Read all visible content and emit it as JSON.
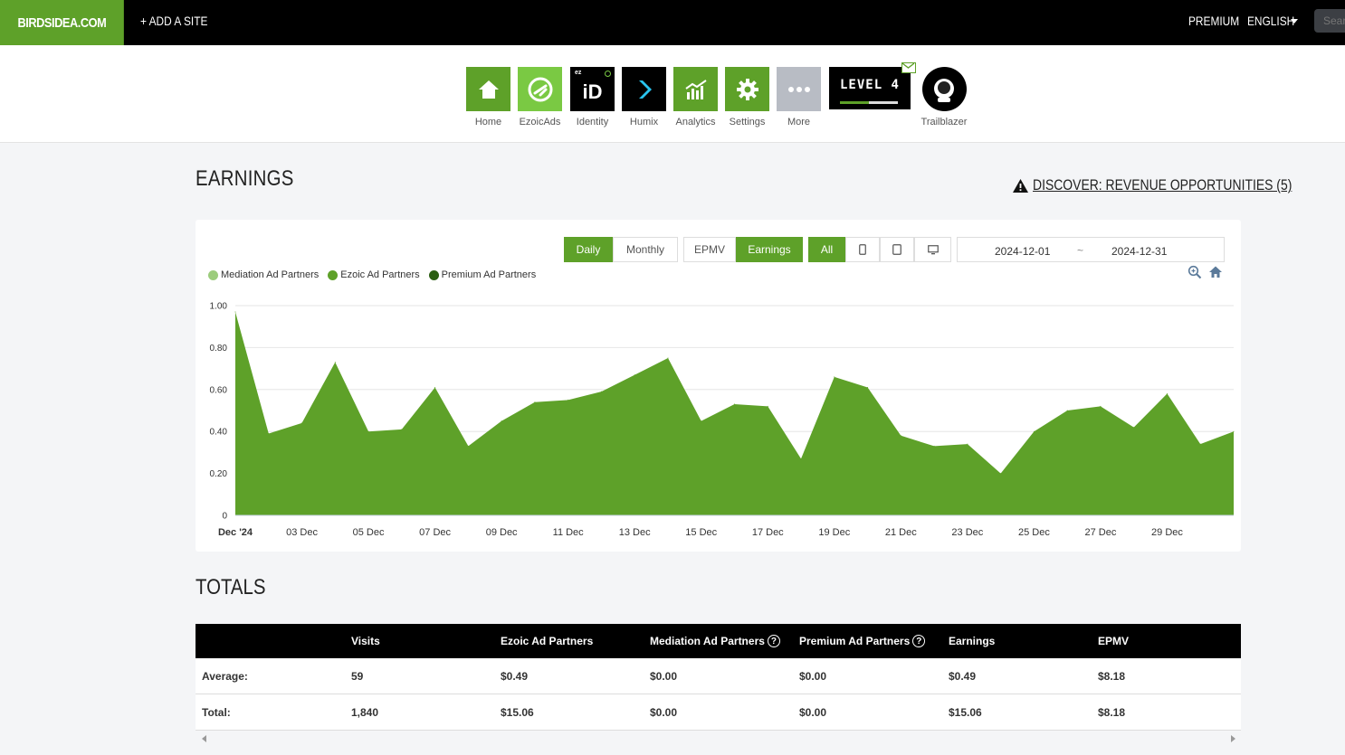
{
  "topbar": {
    "brand": "BIRDSIDEA.COM",
    "add_site": "+ ADD A SITE",
    "premium": "PREMIUM",
    "language": "ENGLISH",
    "search_placeholder": "Search"
  },
  "apps": [
    {
      "label": "Home",
      "icon": "home-icon"
    },
    {
      "label": "EzoicAds",
      "icon": "ezoicads-icon"
    },
    {
      "label": "Identity",
      "icon": "identity-icon"
    },
    {
      "label": "Humix",
      "icon": "humix-icon"
    },
    {
      "label": "Analytics",
      "icon": "analytics-icon"
    },
    {
      "label": "Settings",
      "icon": "gear-icon"
    },
    {
      "label": "More",
      "icon": "more-icon"
    }
  ],
  "level": {
    "text": "LEVEL 4",
    "progress": 0.5
  },
  "profile": {
    "label": "Trailblazer"
  },
  "identity_tile": {
    "small": "ez",
    "big": "iD"
  },
  "earnings": {
    "title": "EARNINGS",
    "discover": "DISCOVER: REVENUE OPPORTUNITIES (5)",
    "toggles": {
      "daily": "Daily",
      "monthly": "Monthly",
      "epmv": "EPMV",
      "earnings": "Earnings",
      "all": "All"
    },
    "date_start": "2024-12-01",
    "date_sep": "~",
    "date_end": "2024-12-31"
  },
  "colors": {
    "accent": "#5ea129",
    "mediation": "#9ccc7c",
    "ezoic": "#5ea129",
    "premium": "#2b5e12"
  },
  "chart_data": {
    "type": "area",
    "title": "",
    "xlabel": "",
    "ylabel": "",
    "ylim": [
      0,
      1
    ],
    "yticks": [
      "0",
      "0.20",
      "0.40",
      "0.60",
      "0.80",
      "1.00"
    ],
    "xtick_labels": [
      "Dec '24",
      "03 Dec",
      "05 Dec",
      "07 Dec",
      "09 Dec",
      "11 Dec",
      "13 Dec",
      "15 Dec",
      "17 Dec",
      "19 Dec",
      "21 Dec",
      "23 Dec",
      "25 Dec",
      "27 Dec",
      "29 Dec"
    ],
    "legend": [
      "Mediation Ad Partners",
      "Ezoic Ad Partners",
      "Premium Ad Partners"
    ],
    "legend_position": "top-left",
    "grid": true,
    "x": [
      "2024-12-01",
      "2024-12-02",
      "2024-12-03",
      "2024-12-04",
      "2024-12-05",
      "2024-12-06",
      "2024-12-07",
      "2024-12-08",
      "2024-12-09",
      "2024-12-10",
      "2024-12-11",
      "2024-12-12",
      "2024-12-13",
      "2024-12-14",
      "2024-12-15",
      "2024-12-16",
      "2024-12-17",
      "2024-12-18",
      "2024-12-19",
      "2024-12-20",
      "2024-12-21",
      "2024-12-22",
      "2024-12-23",
      "2024-12-24",
      "2024-12-25",
      "2024-12-26",
      "2024-12-27",
      "2024-12-28",
      "2024-12-29",
      "2024-12-30",
      "2024-12-31"
    ],
    "series": [
      {
        "name": "Ezoic Ad Partners",
        "values": [
          0.97,
          0.39,
          0.44,
          0.73,
          0.4,
          0.41,
          0.61,
          0.33,
          0.45,
          0.54,
          0.55,
          0.59,
          0.67,
          0.75,
          0.45,
          0.53,
          0.52,
          0.27,
          0.66,
          0.61,
          0.38,
          0.33,
          0.34,
          0.2,
          0.4,
          0.5,
          0.52,
          0.42,
          0.58,
          0.34,
          0.4
        ]
      },
      {
        "name": "Mediation Ad Partners",
        "values": [
          0,
          0,
          0,
          0,
          0,
          0,
          0,
          0,
          0,
          0,
          0,
          0,
          0,
          0,
          0,
          0,
          0,
          0,
          0,
          0,
          0,
          0,
          0,
          0,
          0,
          0,
          0,
          0,
          0,
          0,
          0
        ]
      },
      {
        "name": "Premium Ad Partners",
        "values": [
          0,
          0,
          0,
          0,
          0,
          0,
          0,
          0,
          0,
          0,
          0,
          0,
          0,
          0,
          0,
          0,
          0,
          0,
          0,
          0,
          0,
          0,
          0,
          0,
          0,
          0,
          0,
          0,
          0,
          0,
          0
        ]
      }
    ]
  },
  "totals": {
    "title": "TOTALS",
    "headers": [
      "",
      "Visits",
      "Ezoic Ad Partners",
      "Mediation Ad Partners",
      "Premium Ad Partners",
      "Earnings",
      "EPMV"
    ],
    "rows": [
      [
        "Average:",
        "59",
        "$0.49",
        "$0.00",
        "$0.00",
        "$0.49",
        "$8.18"
      ],
      [
        "Total:",
        "1,840",
        "$15.06",
        "$0.00",
        "$0.00",
        "$15.06",
        "$8.18"
      ]
    ]
  }
}
